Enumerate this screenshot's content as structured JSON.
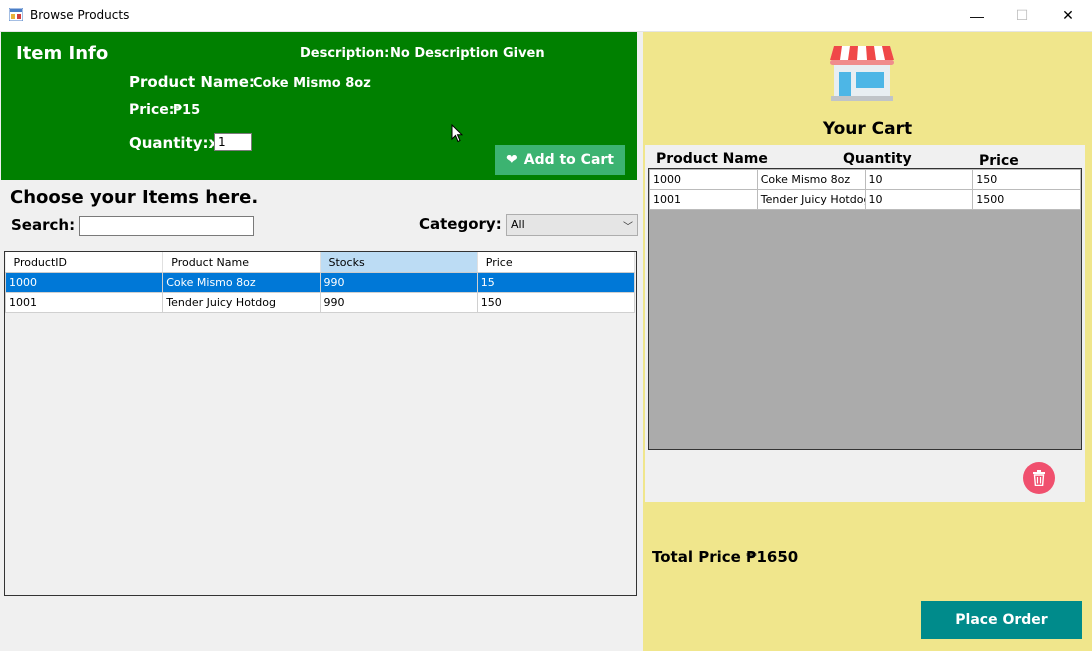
{
  "window": {
    "title": "Browse Products",
    "minimize": "—",
    "maximize": "☐",
    "close": "✕"
  },
  "item_info": {
    "heading": "Item Info",
    "description_label": "Description:",
    "description_value": "No Description Given",
    "product_name_label": "Product Name:",
    "product_name_value": "Coke Mismo 8oz",
    "price_label": "Price:",
    "price_value": "₱15",
    "quantity_label": "Quantity:x",
    "quantity_value": "1",
    "add_to_cart_label": "Add to Cart",
    "heart_icon": "heart-icon"
  },
  "browse": {
    "heading": "Choose your Items here.",
    "search_label": "Search:",
    "search_value": "",
    "category_label": "Category:",
    "category_selected": "All",
    "columns": [
      "ProductID",
      "Product Name",
      "Stocks",
      "Price"
    ],
    "rows": [
      [
        "1000",
        "Coke Mismo 8oz",
        "990",
        "15"
      ],
      [
        "1001",
        "Tender Juicy Hotdog",
        "990",
        "150"
      ]
    ]
  },
  "cart": {
    "title": "Your Cart",
    "headers": {
      "product_name": "Product Name",
      "quantity": "Quantity",
      "price": "Price"
    },
    "rows": [
      [
        "1000",
        "Coke Mismo 8oz",
        "10",
        "150"
      ],
      [
        "1001",
        "Tender Juicy Hotdog",
        "10",
        "1500"
      ]
    ],
    "total": "Total Price ₱1650",
    "place_order_label": "Place Order",
    "store_icon": "store-icon",
    "trash_icon": "trash-icon"
  },
  "colors": {
    "info_bg": "#008000",
    "add_button": "#3cb371",
    "cart_bg": "#f0e68c",
    "order_button": "#008b8b",
    "selection": "#0078d7",
    "trash_button": "#f0506e"
  }
}
